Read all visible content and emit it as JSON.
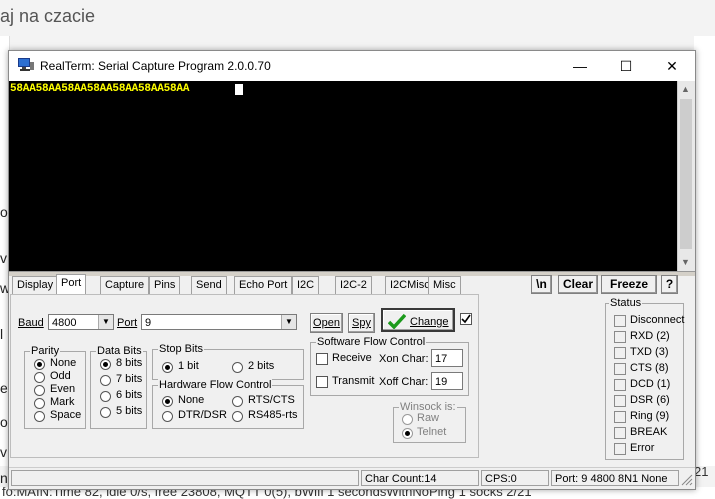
{
  "background": {
    "top_text": "aj na czacie",
    "left_letters": [
      "o",
      "v",
      "w",
      "l",
      "e",
      "o",
      "v",
      "n"
    ],
    "bottom_log": "fo:MAIN:Time 82, idle 0/s, free 23808, MQTT 0(5), bWifi 1 secondsWithNoPing 1 socks 2/21",
    "right_text": "21"
  },
  "window": {
    "title": "RealTerm: Serial Capture Program 2.0.0.70",
    "minimize": "—",
    "maximize": "☐",
    "close": "✕"
  },
  "terminal": {
    "text": "58AA58AA58AA58AA58AA58AA58AA"
  },
  "tabs": [
    "Display",
    "Port",
    "Capture",
    "Pins",
    "Send",
    "Echo Port",
    "I2C",
    "I2C-2",
    "I2CMisc",
    "Misc"
  ],
  "active_tab": "Port",
  "header_buttons": {
    "newline": "\\n",
    "clear": "Clear",
    "freeze": "Freeze",
    "help": "?"
  },
  "port_panel": {
    "baud_label": "Baud",
    "baud_value": "4800",
    "port_label": "Port",
    "port_value": "9",
    "open_button": "Open",
    "spy_button": "Spy",
    "change_button": "Change",
    "parity": {
      "title": "Parity",
      "options": [
        "None",
        "Odd",
        "Even",
        "Mark",
        "Space"
      ],
      "selected": "None"
    },
    "data_bits": {
      "title": "Data Bits",
      "options": [
        "8 bits",
        "7 bits",
        "6 bits",
        "5 bits"
      ],
      "selected": "8 bits"
    },
    "stop_bits": {
      "title": "Stop Bits",
      "options": [
        "1 bit",
        "2 bits"
      ],
      "selected": "1 bit"
    },
    "hw_flow": {
      "title": "Hardware Flow Control",
      "options": [
        "None",
        "RTS/CTS",
        "DTR/DSR",
        "RS485-rts"
      ],
      "selected": "None"
    },
    "sw_flow": {
      "title": "Software Flow Control",
      "receive_label": "Receive",
      "transmit_label": "Transmit",
      "xon_label": "Xon Char:",
      "xon_value": "17",
      "xoff_label": "Xoff Char:",
      "xoff_value": "19"
    },
    "winsock": {
      "title": "Winsock is:",
      "options": [
        "Raw",
        "Telnet"
      ],
      "selected": "Telnet"
    }
  },
  "status_group": {
    "title": "Status",
    "items": [
      "Disconnect",
      "RXD (2)",
      "TXD (3)",
      "CTS (8)",
      "DCD (1)",
      "DSR (6)",
      "Ring (9)",
      "BREAK",
      "Error"
    ]
  },
  "statusbar": {
    "char_count": "Char Count:14",
    "cps": "CPS:0",
    "port_info": "Port: 9 4800 8N1 None"
  }
}
